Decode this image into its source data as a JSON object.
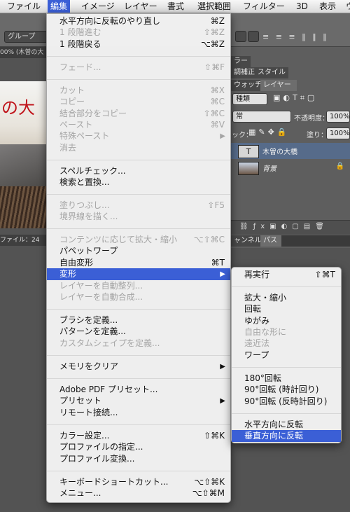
{
  "menubar": {
    "items": [
      "ファイル",
      "編集",
      "イメージ",
      "レイヤー",
      "書式",
      "選択範囲",
      "フィルター",
      "3D",
      "表示",
      "ウ"
    ]
  },
  "background": {
    "options_dropdown": "グループ",
    "doc_tab": "00% (木曽の大",
    "status_left": "ファイル：24",
    "panel_tabs_top": [
      "ラー"
    ],
    "panel_tabs_row2": [
      "調補正",
      "スタイル"
    ],
    "panel_tabs_row3": [
      "ウォッチ",
      "レイヤー"
    ],
    "kind_filter": "種類",
    "blend_mode": "常",
    "opacity_label": "不透明度：",
    "opacity_value": "100%",
    "lock_label": "ック：",
    "fill_label": "塗り：",
    "fill_value": "100%",
    "layers": [
      {
        "name": "木曽の大橋",
        "thumb": "T",
        "selected": true
      },
      {
        "name": "背景",
        "thumb": "",
        "selected": false
      }
    ],
    "bottom_tabs": [
      "ャンネル",
      "パス"
    ],
    "accent_color": "#3b5fd6"
  },
  "edit_menu": {
    "items": [
      {
        "label": "水平方向に反転のやり直し",
        "shortcut": "⌘Z",
        "disabled": false
      },
      {
        "label": "1 段階進む",
        "shortcut": "⇧⌘Z",
        "disabled": true
      },
      {
        "label": "1 段階戻る",
        "shortcut": "⌥⌘Z",
        "disabled": false
      },
      {
        "label": "フェード...",
        "shortcut": "⇧⌘F",
        "disabled": true
      },
      {
        "label": "カット",
        "shortcut": "⌘X",
        "disabled": true
      },
      {
        "label": "コピー",
        "shortcut": "⌘C",
        "disabled": true
      },
      {
        "label": "結合部分をコピー",
        "shortcut": "⇧⌘C",
        "disabled": true
      },
      {
        "label": "ペースト",
        "shortcut": "⌘V",
        "disabled": true
      },
      {
        "label": "特殊ペースト",
        "shortcut": "▶",
        "disabled": true
      },
      {
        "label": "消去",
        "shortcut": "",
        "disabled": true
      },
      {
        "label": "スペルチェック...",
        "shortcut": "",
        "disabled": false
      },
      {
        "label": "検索と置換...",
        "shortcut": "",
        "disabled": false
      },
      {
        "label": "塗りつぶし...",
        "shortcut": "⇧F5",
        "disabled": true
      },
      {
        "label": "境界線を描く...",
        "shortcut": "",
        "disabled": true
      },
      {
        "label": "コンテンツに応じて拡大・縮小",
        "shortcut": "⌥⇧⌘C",
        "disabled": true
      },
      {
        "label": "パペットワープ",
        "shortcut": "",
        "disabled": false
      },
      {
        "label": "自由変形",
        "shortcut": "⌘T",
        "disabled": false
      },
      {
        "label": "変形",
        "shortcut": "▶",
        "disabled": false,
        "highlighted": true
      },
      {
        "label": "レイヤーを自動整列...",
        "shortcut": "",
        "disabled": true
      },
      {
        "label": "レイヤーを自動合成...",
        "shortcut": "",
        "disabled": true
      },
      {
        "label": "ブラシを定義...",
        "shortcut": "",
        "disabled": false
      },
      {
        "label": "パターンを定義...",
        "shortcut": "",
        "disabled": false
      },
      {
        "label": "カスタムシェイプを定義...",
        "shortcut": "",
        "disabled": true
      },
      {
        "label": "メモリをクリア",
        "shortcut": "▶",
        "disabled": false
      },
      {
        "label": "Adobe PDF プリセット...",
        "shortcut": "",
        "disabled": false
      },
      {
        "label": "プリセット",
        "shortcut": "▶",
        "disabled": false
      },
      {
        "label": "リモート接続...",
        "shortcut": "",
        "disabled": false
      },
      {
        "label": "カラー設定...",
        "shortcut": "⇧⌘K",
        "disabled": false
      },
      {
        "label": "プロファイルの指定...",
        "shortcut": "",
        "disabled": false
      },
      {
        "label": "プロファイル変換...",
        "shortcut": "",
        "disabled": false
      },
      {
        "label": "キーボードショートカット...",
        "shortcut": "⌥⇧⌘K",
        "disabled": false
      },
      {
        "label": "メニュー...",
        "shortcut": "⌥⇧⌘M",
        "disabled": false
      }
    ]
  },
  "transform_submenu": {
    "items": [
      {
        "label": "再実行",
        "shortcut": "⇧⌘T",
        "disabled": false
      },
      {
        "label": "拡大・縮小",
        "shortcut": "",
        "disabled": false
      },
      {
        "label": "回転",
        "shortcut": "",
        "disabled": false
      },
      {
        "label": "ゆがみ",
        "shortcut": "",
        "disabled": false
      },
      {
        "label": "自由な形に",
        "shortcut": "",
        "disabled": true
      },
      {
        "label": "遠近法",
        "shortcut": "",
        "disabled": true
      },
      {
        "label": "ワープ",
        "shortcut": "",
        "disabled": false
      },
      {
        "label": "180°回転",
        "shortcut": "",
        "disabled": false
      },
      {
        "label": "90°回転 (時計回り)",
        "shortcut": "",
        "disabled": false
      },
      {
        "label": "90°回転 (反時計回り)",
        "shortcut": "",
        "disabled": false
      },
      {
        "label": "水平方向に反転",
        "shortcut": "",
        "disabled": false
      },
      {
        "label": "垂直方向に反転",
        "shortcut": "",
        "disabled": false,
        "highlighted": true
      }
    ]
  }
}
